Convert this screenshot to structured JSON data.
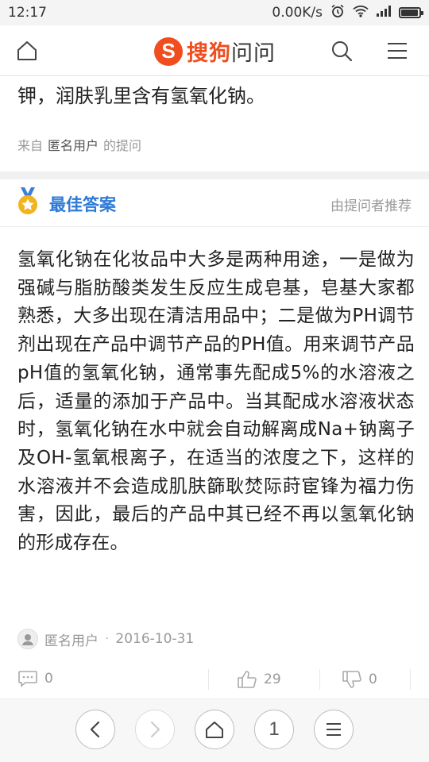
{
  "status_bar": {
    "time": "12:17",
    "speed": "0.00K/s"
  },
  "header": {
    "logo_mark": "S",
    "logo_brand": "搜狗",
    "logo_suffix": "问问"
  },
  "question": {
    "tail_text": "钾，润肤乳里含有氢氧化钠。",
    "meta_from": "来自",
    "meta_user": "匿名用户",
    "meta_suffix": "的提问"
  },
  "best_answer": {
    "title": "最佳答案",
    "recommend": "由提问者推荐",
    "text": "氢氧化钠在化妆品中大多是两种用途，一是做为强碱与脂肪酸类发生反应生成皂基，皂基大家都熟悉，大多出现在清洁用品中；二是做为PH调节剂出现在产品中调节产品的PH值。用来调节产品pH值的氢氧化钠，通常事先配成5%的水溶液之后，适量的添加于产品中。当其配成水溶液状态时，氢氧化钠在水中就会自动解离成Na+钠离子及OH-氢氧根离子，在适当的浓度之下，这样的水溶液并不会造成肌肤篩耿焚际莳宦锋为福力伤害，因此，最后的产品中其已经不再以氢氧化钠的形成存在。",
    "author": "匿名用户",
    "separator": "·",
    "date": "2016-10-31"
  },
  "actions": {
    "comments": "0",
    "likes": "29",
    "dislikes": "0"
  },
  "bottom_nav": {
    "page": "1"
  },
  "colors": {
    "brand": "#f04e1f",
    "best_title": "#2d7ad6",
    "muted": "#999999"
  }
}
